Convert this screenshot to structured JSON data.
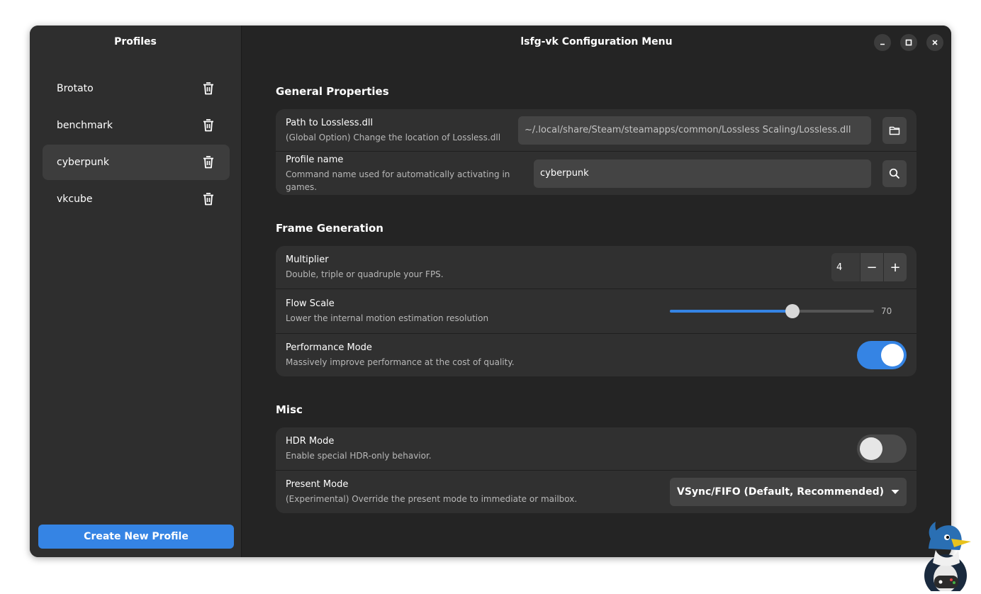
{
  "sidebar": {
    "title": "Profiles",
    "items": [
      {
        "label": "Brotato"
      },
      {
        "label": "benchmark"
      },
      {
        "label": "cyberpunk"
      },
      {
        "label": "vkcube"
      }
    ],
    "create_label": "Create New Profile"
  },
  "window": {
    "title": "lsfg-vk Configuration Menu"
  },
  "general": {
    "title": "General Properties",
    "path": {
      "label": "Path to Lossless.dll",
      "sub": "(Global Option) Change the location of Lossless.dll",
      "value": "~/.local/share/Steam/steamapps/common/Lossless Scaling/Lossless.dll"
    },
    "profile_name": {
      "label": "Profile name",
      "sub": "Command name used for automatically activating in games.",
      "value": "cyberpunk"
    }
  },
  "framegen": {
    "title": "Frame Generation",
    "multiplier": {
      "label": "Multiplier",
      "sub": "Double, triple or quadruple your FPS.",
      "value": "4",
      "minus": "−",
      "plus": "+"
    },
    "flow_scale": {
      "label": "Flow Scale",
      "sub": "Lower the internal motion estimation resolution",
      "value": "70",
      "fraction": 0.6
    },
    "performance": {
      "label": "Performance Mode",
      "sub": "Massively improve performance at the cost of quality.",
      "enabled": true
    }
  },
  "misc": {
    "title": "Misc",
    "hdr": {
      "label": "HDR Mode",
      "sub": "Enable special HDR-only behavior.",
      "enabled": false
    },
    "present": {
      "label": "Present Mode",
      "sub": "(Experimental) Override the present mode to immediate or mailbox.",
      "value": "VSync/FIFO (Default, Recommended)"
    }
  },
  "colors": {
    "accent": "#3584e4",
    "window_bg": "#242424",
    "sidebar_bg": "#2e2e2e",
    "card_bg": "#303030"
  }
}
